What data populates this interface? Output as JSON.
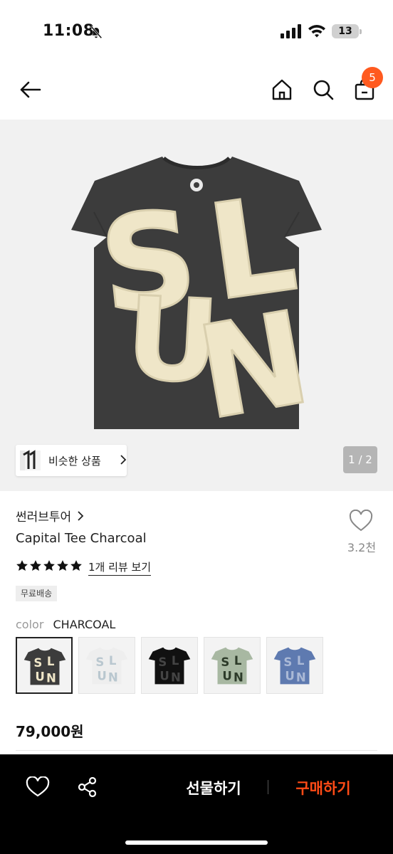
{
  "status_bar": {
    "time": "11:08",
    "battery": "13"
  },
  "header": {
    "back_icon": "arrow-left-icon",
    "home_icon": "home-icon",
    "search_icon": "search-icon",
    "cart_icon": "shopping-bag-icon",
    "cart_count": "5"
  },
  "hero": {
    "shirt_letters": [
      "S",
      "L",
      "U",
      "N"
    ],
    "similar_label": "비슷한 상품",
    "pager": "1 / 2"
  },
  "product": {
    "brand": "썬러브투어",
    "name": "Capital Tee Charcoal",
    "likes": "3.2천",
    "rating_stars": 5,
    "review_link": "1개 리뷰 보기",
    "shipping_badge": "무료배송",
    "color_label": "color",
    "color_value": "CHARCOAL",
    "swatches": [
      {
        "shirt": "#3c3c3c",
        "letters": "#efe6c8",
        "selected": true
      },
      {
        "shirt": "#eeeeee",
        "letters": "#b9c7cf",
        "selected": false
      },
      {
        "shirt": "#111111",
        "letters": "#444444",
        "selected": false
      },
      {
        "shirt": "#a8b8a2",
        "letters": "#2d3b2a",
        "selected": false
      },
      {
        "shirt": "#5e7ab0",
        "letters": "#aab9d6",
        "selected": false
      }
    ],
    "price": "79,000원"
  },
  "bottom_bar": {
    "gift_label": "선물하기",
    "buy_label": "구매하기"
  },
  "colors": {
    "accent": "#ff4b16",
    "badge": "#ff5a1f",
    "shirt": "#3c3c3c",
    "patch": "#efe6c8"
  }
}
